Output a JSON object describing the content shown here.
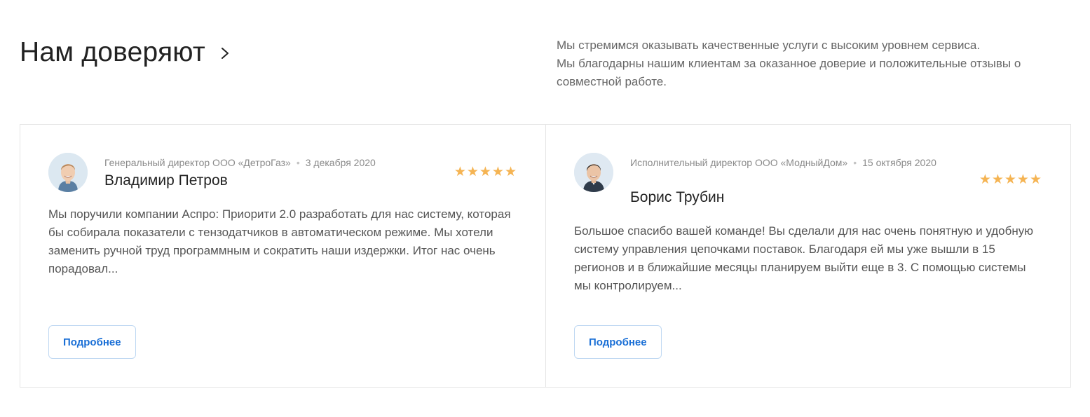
{
  "section": {
    "title": "Нам доверяют",
    "title_icon": "chevron-right-icon",
    "intro_lines": [
      "Мы стремимся оказывать качественные услуги с высоким уровнем сервиса.",
      "Мы благодарны нашим клиентам за оказанное доверие и положительные отзывы о совместной работе."
    ]
  },
  "reviews": [
    {
      "position": "Генеральный директор ООО «ДетроГаз»",
      "separator": "•",
      "date": "3 декабря 2020",
      "name": "Владимир Петров",
      "rating": 5,
      "stars": "★★★★★",
      "text": "Мы поручили компании Аспро: Приорити 2.0 разработать для нас систему, которая бы собирала показатели с тензодатчиков в автоматическом режиме. Мы хотели заменить ручной труд программным и сократить наши издержки. Итог нас очень порадовал...",
      "button_label": "Подробнее",
      "avatar_icon": "avatar-man-icon"
    },
    {
      "position": "Исполнительный директор ООО «МодныйДом»",
      "separator": "•",
      "date": "15 октября 2020",
      "name": "Борис Трубин",
      "rating": 5,
      "stars": "★★★★★",
      "text": "Большое спасибо вашей команде! Вы сделали для нас очень понятную и удобную систему управления цепочками поставок. Благодаря ей мы уже вышли в 15 регионов и в ближайшие месяцы планируем выйти еще в 3. С помощью системы мы контролируем...",
      "button_label": "Подробнее",
      "avatar_icon": "avatar-man-icon"
    }
  ],
  "colors": {
    "accent": "#1a6fd6",
    "star": "#f5b453",
    "border": "#e5e5e5"
  }
}
